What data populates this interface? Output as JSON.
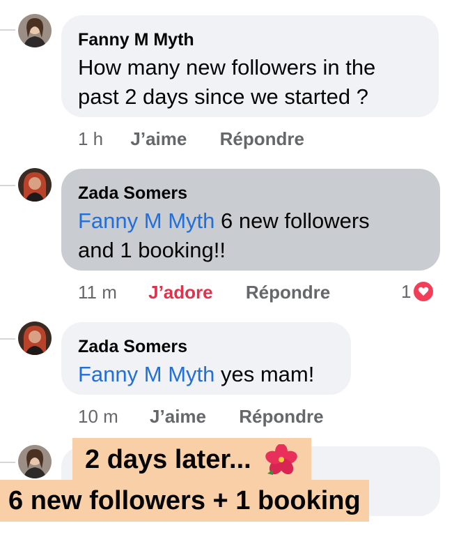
{
  "comments": [
    {
      "author": "Fanny M Myth",
      "text_line1": "How many new followers in the",
      "text_line2": "past 2 days since we started ?",
      "time": "1 h",
      "like": "J’aime",
      "reply": "Répondre"
    },
    {
      "author": "Zada Somers",
      "mention": "Fanny M Myth",
      "text_line1": " 6 new followers",
      "text_line2": "and 1 booking!!",
      "time": "11 m",
      "like": "J’adore",
      "reply": "Répondre",
      "reaction_count": "1"
    },
    {
      "author": "Zada Somers",
      "mention": "Fanny M Myth",
      "text_line1": " yes mam!",
      "time": "10 m",
      "like": "J’aime",
      "reply": "Répondre"
    }
  ],
  "overlay": {
    "line1": "2 days later...",
    "line2": "6 new followers + 1 booking",
    "emoji": "hibiscus-icon"
  },
  "colors": {
    "mention": "#216fdb",
    "love": "#e0324a",
    "highlight_bubble": "#c9ccd1",
    "overlay_bg": "#f8cfa6"
  }
}
